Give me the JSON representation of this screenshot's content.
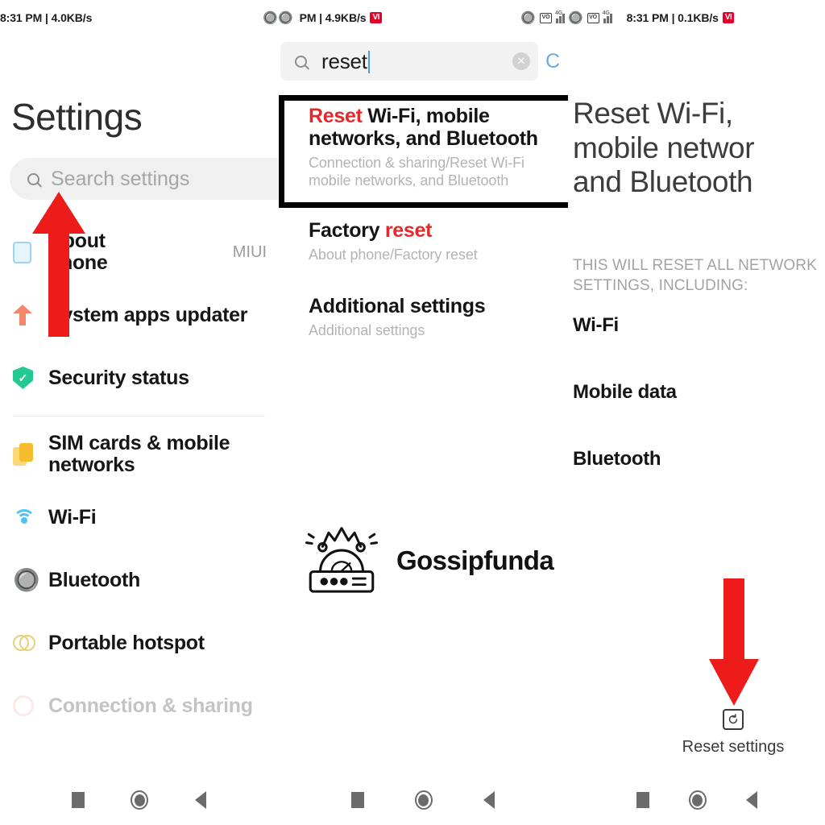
{
  "panels": {
    "left": {
      "status_bar": {
        "clock": "8:31 PM | 4.0KB/s",
        "bluetooth_icon": "bluetooth-icon"
      },
      "title": "Settings",
      "search": {
        "placeholder": "Search settings",
        "icon": "search-icon"
      },
      "items": [
        {
          "label": "About\nphone",
          "value": "MIUI",
          "icon": "about-phone-icon"
        },
        {
          "label": "System apps updater",
          "value": "",
          "icon": "system-update-icon"
        },
        {
          "label": "Security status",
          "value": "",
          "icon": "shield-check-icon"
        },
        {
          "label": "SIM cards & mobile\nnetworks",
          "value": "",
          "icon": "sim-card-icon"
        },
        {
          "label": "Wi-Fi",
          "value": "",
          "icon": "wifi-icon"
        },
        {
          "label": "Bluetooth",
          "value": "",
          "icon": "bluetooth-icon"
        },
        {
          "label": "Portable hotspot",
          "value": "",
          "icon": "hotspot-icon"
        },
        {
          "label": "Connection & sharing",
          "value": "",
          "icon": "connection-sharing-icon"
        }
      ],
      "annotation_arrow": "red-up-arrow-pointing-to-search"
    },
    "middle": {
      "status_bar": {
        "clock": "PM | 4.9KB/s",
        "carrier_badge": "VI",
        "bluetooth_icon": "bluetooth-icon"
      },
      "search": {
        "value": "reset",
        "clear_icon": "clear-icon",
        "cancel_label": "C",
        "back_icon": "back-arrow-icon",
        "search_icon": "search-icon"
      },
      "results": [
        {
          "title_prefix": "Reset",
          "title_rest": " Wi-Fi, mobile\nnetworks, and Bluetooth",
          "subtitle": "Connection & sharing/Reset Wi-Fi\nmobile networks, and Bluetooth",
          "highlighted": true
        },
        {
          "title_prefix": "Factory ",
          "title_rest": "reset",
          "subtitle": "About phone/Factory reset",
          "highlighted": false
        },
        {
          "title_prefix": "Additional settings",
          "title_rest": "",
          "subtitle": "Additional settings",
          "highlighted": false
        }
      ]
    },
    "right": {
      "status_bar": {
        "clock": "8:31 PM | 0.1KB/s",
        "carrier_badge": "VI"
      },
      "title": "Reset Wi-Fi,\nmobile networ\nand Bluetooth",
      "note": "THIS WILL RESET ALL NETWORK SETTINGS, INCLUDING:",
      "items": [
        "Wi-Fi",
        "Mobile data",
        "Bluetooth"
      ],
      "reset_button": {
        "label": "Reset settings",
        "icon": "reset-icon"
      },
      "annotation_arrow": "red-down-arrow-pointing-to-reset-settings"
    }
  },
  "watermark": {
    "text": "Gossipfunda",
    "icon": "gossipfunda-logo"
  },
  "navigation": {
    "recents": "recents-icon",
    "home": "home-icon",
    "back": "back-icon"
  },
  "colors": {
    "accent_red": "#e3292b",
    "arrow_red": "#ee1b1b",
    "highlight_blue": "#6aacdd",
    "carrier_red": "#e4002b"
  }
}
